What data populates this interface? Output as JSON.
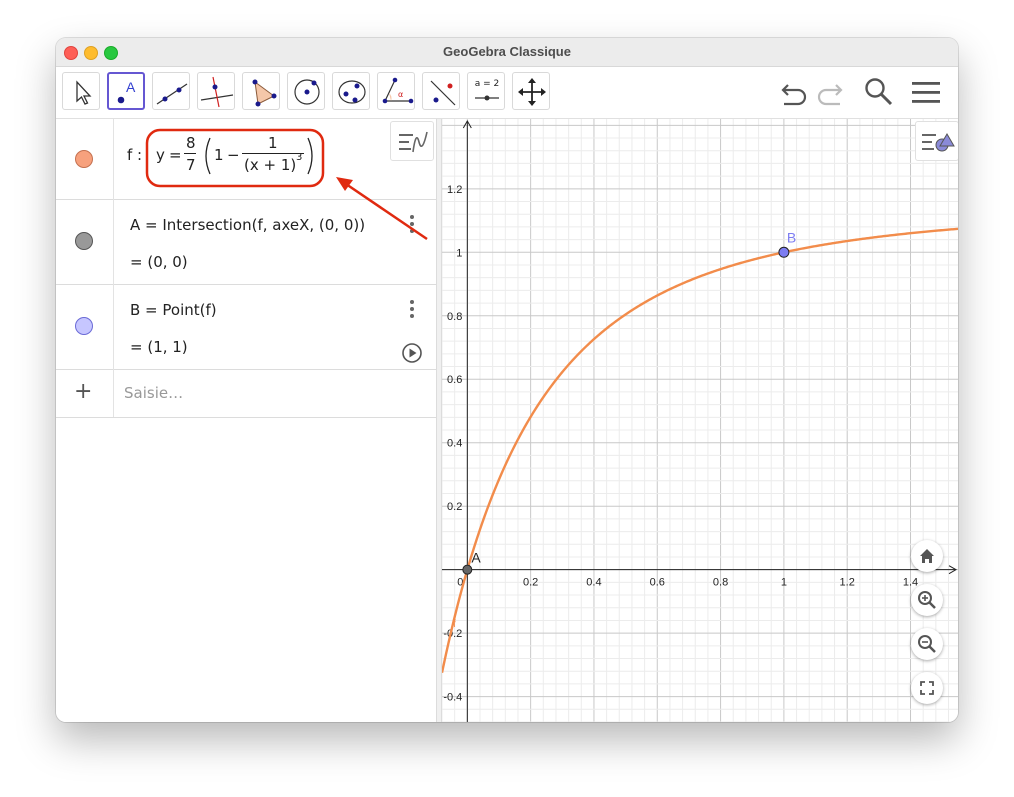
{
  "window": {
    "title": "GeoGebra Classique"
  },
  "toolbar": {
    "tools": [
      "move-tool",
      "point-tool",
      "line-tool",
      "perpendicular-line-tool",
      "polygon-tool",
      "circle-tool",
      "conic-tool",
      "angle-tool",
      "reflect-tool",
      "slider-tool",
      "move-graphics-tool"
    ],
    "slider_label": "a = 2",
    "right": [
      "undo-icon",
      "redo-icon",
      "search-icon",
      "menu-icon"
    ]
  },
  "algebra": {
    "rows": [
      {
        "name": "f",
        "color": "#f7a17d",
        "definition_prefix": "f :",
        "y": "y",
        "eq": "=",
        "frac_num": "8",
        "frac_den": "7",
        "one": "1",
        "minus": "−",
        "inner_num": "1",
        "inner_den": "(x + 1)",
        "exponent": "3"
      },
      {
        "name": "A",
        "color": "#999999",
        "definition": "A  =  Intersection(f, axeX, (0, 0))",
        "value": "=  (0, 0)"
      },
      {
        "name": "B",
        "color": "#c6c6ff",
        "definition": "B  =  Point(f)",
        "value": "=  (1, 1)"
      }
    ],
    "input_placeholder": "Saisie…",
    "plus": "+"
  },
  "graph": {
    "x_ticks": [
      "0",
      "0.2",
      "0.4",
      "0.6",
      "0.8",
      "1",
      "1.2",
      "1.4"
    ],
    "y_ticks": [
      "1.2",
      "1",
      "0.8",
      "0.6",
      "0.4",
      "0.2",
      "-0.2",
      "-0.4"
    ],
    "point_A_label": "A",
    "point_B_label": "B",
    "curve_label": "f",
    "curve_color": "#f28c4b",
    "point_B_color": "#7d7df2"
  },
  "chart_data": {
    "type": "line",
    "series": [
      {
        "name": "f",
        "expression": "8/7*(1-1/(x+1)^3)"
      }
    ],
    "points": [
      {
        "name": "A",
        "x": 0,
        "y": 0
      },
      {
        "name": "B",
        "x": 1,
        "y": 1
      }
    ],
    "xlim": [
      -0.08,
      1.55
    ],
    "ylim": [
      -0.48,
      1.42
    ],
    "grid": true
  },
  "annotation": {
    "color": "#e02a10"
  }
}
